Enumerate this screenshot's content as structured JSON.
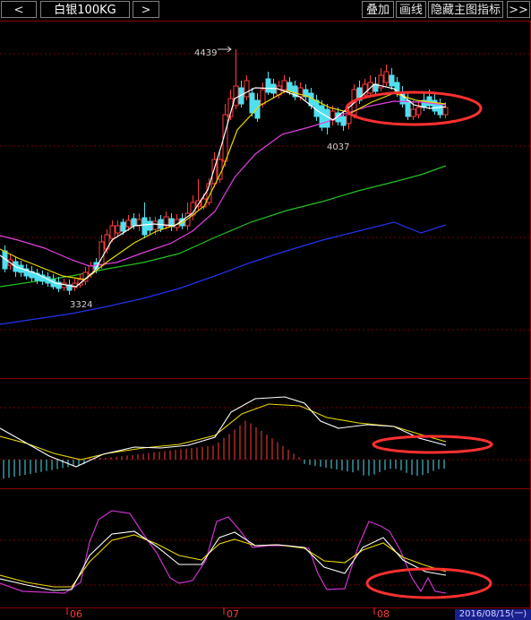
{
  "toolbar": {
    "prev_symbol": "<",
    "symbol": "白银100KG",
    "next_symbol": ">",
    "overlay": "叠加",
    "draw_line": "画线",
    "hide_indicator": "隐藏主图指标",
    "collapse": ">>"
  },
  "main_chart": {
    "high_label": "4439",
    "low_label_1": "3324",
    "low_label_2": "4037"
  },
  "x_axis": {
    "months": [
      "06",
      "07",
      "08"
    ],
    "current_date": "2016/08/15(一)"
  },
  "colors": {
    "up": "#ff3b3b",
    "down": "#4fe0f0",
    "ma5": "#ffffff",
    "ma10": "#e8d800",
    "ma20": "#e040e0",
    "ma60": "#22c022",
    "ma120": "#2233ee",
    "annotation": "#ff3030",
    "grid": "#7a0000"
  }
}
